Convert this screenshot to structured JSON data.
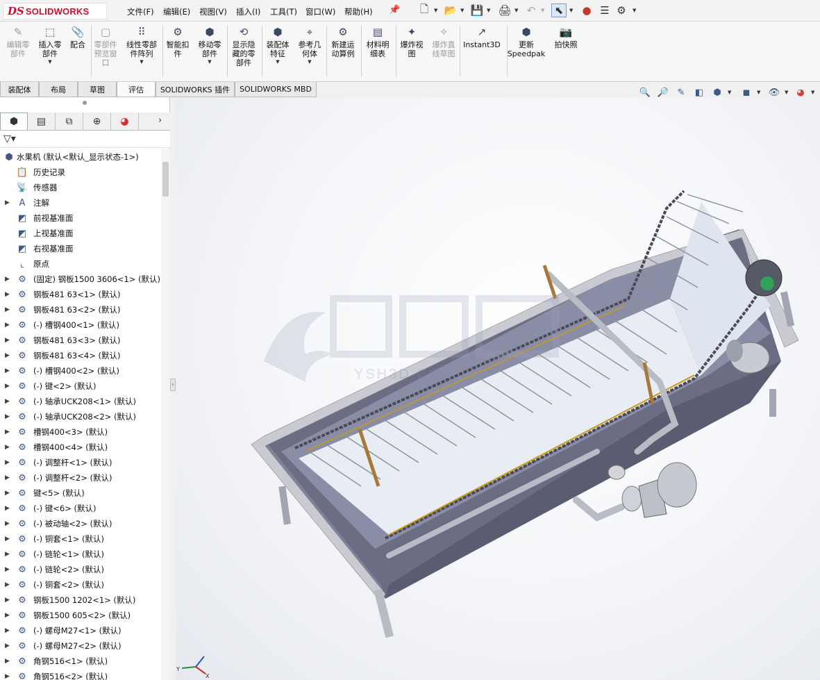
{
  "app": {
    "brand_mark": "DS",
    "brand_name": "SOLIDWORKS"
  },
  "menu": [
    "文件(F)",
    "编辑(E)",
    "视图(V)",
    "插入(I)",
    "工具(T)",
    "窗口(W)",
    "帮助(H)"
  ],
  "ribbon": [
    {
      "label": "编辑零\n部件",
      "icon": "edit-component-icon",
      "enabled": false
    },
    {
      "label": "插入零\n部件",
      "icon": "insert-component-icon",
      "enabled": true,
      "dropdown": true
    },
    {
      "label": "配合",
      "icon": "mate-icon",
      "enabled": true
    },
    {
      "label": "零部件\n预览窗\n口",
      "icon": "component-preview-icon",
      "enabled": false
    },
    {
      "label": "线性零部\n件阵列",
      "icon": "linear-pattern-icon",
      "enabled": true,
      "dropdown": true
    },
    {
      "label": "智能扣\n件",
      "icon": "smart-fasteners-icon",
      "enabled": true
    },
    {
      "label": "移动零\n部件",
      "icon": "move-component-icon",
      "enabled": true,
      "dropdown": true
    },
    {
      "label": "显示隐\n藏的零\n部件",
      "icon": "show-hidden-icon",
      "enabled": true
    },
    {
      "label": "装配体\n特征",
      "icon": "assembly-features-icon",
      "enabled": true,
      "dropdown": true
    },
    {
      "label": "参考几\n何体",
      "icon": "reference-geometry-icon",
      "enabled": true,
      "dropdown": true
    },
    {
      "label": "新建运\n动算例",
      "icon": "new-motion-study-icon",
      "enabled": true
    },
    {
      "label": "材料明\n细表",
      "icon": "bill-of-materials-icon",
      "enabled": true
    },
    {
      "label": "爆炸视\n图",
      "icon": "exploded-view-icon",
      "enabled": true
    },
    {
      "label": "爆炸直\n线草图",
      "icon": "explode-line-sketch-icon",
      "enabled": false
    },
    {
      "label": "Instant3D",
      "icon": "instant3d-icon",
      "enabled": true
    },
    {
      "label": "更新\nSpeedpak",
      "icon": "speedpak-icon",
      "enabled": true
    },
    {
      "label": "拍快照",
      "icon": "snapshot-icon",
      "enabled": true
    }
  ],
  "tabs": [
    "装配体",
    "布局",
    "草图",
    "评估",
    "SOLIDWORKS 插件",
    "SOLIDWORKS MBD"
  ],
  "active_tab": "评估",
  "tree": {
    "root": "水果机 (默认<默认_显示状态-1>)",
    "items": [
      {
        "label": "历史记录",
        "icon": "history-icon",
        "expand": false
      },
      {
        "label": "传感器",
        "icon": "sensor-icon",
        "expand": false
      },
      {
        "label": "注解",
        "icon": "annotations-icon",
        "expand": true
      },
      {
        "label": "前视基准面",
        "icon": "plane-icon",
        "expand": false
      },
      {
        "label": "上视基准面",
        "icon": "plane-icon",
        "expand": false
      },
      {
        "label": "右视基准面",
        "icon": "plane-icon",
        "expand": false
      },
      {
        "label": "原点",
        "icon": "origin-icon",
        "expand": false
      },
      {
        "label": "(固定) 钢板1500 3606<1> (默认)",
        "icon": "part-icon",
        "expand": true
      },
      {
        "label": "钢板481 63<1> (默认)",
        "icon": "part-icon",
        "expand": true
      },
      {
        "label": "钢板481 63<2> (默认)",
        "icon": "part-icon",
        "expand": true
      },
      {
        "label": "(-) 槽钢400<1> (默认)",
        "icon": "part-icon",
        "expand": true
      },
      {
        "label": "钢板481 63<3> (默认)",
        "icon": "part-icon",
        "expand": true
      },
      {
        "label": "钢板481 63<4> (默认)",
        "icon": "part-icon",
        "expand": true
      },
      {
        "label": "(-) 槽钢400<2> (默认)",
        "icon": "part-icon",
        "expand": true
      },
      {
        "label": "(-) 键<2> (默认)",
        "icon": "part-icon",
        "expand": true
      },
      {
        "label": "(-) 轴承UCK208<1> (默认)",
        "icon": "part-icon",
        "expand": true
      },
      {
        "label": "(-) 轴承UCK208<2> (默认)",
        "icon": "part-icon",
        "expand": true
      },
      {
        "label": "槽钢400<3> (默认)",
        "icon": "part-icon",
        "expand": true
      },
      {
        "label": "槽钢400<4> (默认)",
        "icon": "part-icon",
        "expand": true
      },
      {
        "label": "(-) 调整杆<1> (默认)",
        "icon": "part-icon",
        "expand": true
      },
      {
        "label": "(-) 调整杆<2> (默认)",
        "icon": "part-icon",
        "expand": true
      },
      {
        "label": "键<5> (默认)",
        "icon": "part-icon",
        "expand": true
      },
      {
        "label": "(-) 键<6> (默认)",
        "icon": "part-icon",
        "expand": true
      },
      {
        "label": "(-) 被动轴<2> (默认)",
        "icon": "part-icon",
        "expand": true
      },
      {
        "label": "(-) 铜套<1> (默认)",
        "icon": "part-icon",
        "expand": true
      },
      {
        "label": "(-) 链轮<1> (默认)",
        "icon": "part-icon",
        "expand": true
      },
      {
        "label": "(-) 链轮<2> (默认)",
        "icon": "part-icon",
        "expand": true
      },
      {
        "label": "(-) 铜套<2> (默认)",
        "icon": "part-icon",
        "expand": true
      },
      {
        "label": "钢板1500 1202<1> (默认)",
        "icon": "part-icon",
        "expand": true
      },
      {
        "label": "钢板1500 605<2> (默认)",
        "icon": "part-icon",
        "expand": true
      },
      {
        "label": "(-) 螺母M27<1> (默认)",
        "icon": "part-icon",
        "expand": true
      },
      {
        "label": "(-) 螺母M27<2> (默认)",
        "icon": "part-icon",
        "expand": true
      },
      {
        "label": "角钢516<1> (默认)",
        "icon": "part-icon",
        "expand": true
      },
      {
        "label": "角钢516<2> (默认)",
        "icon": "part-icon",
        "expand": true
      }
    ]
  },
  "watermark": {
    "text": "YSH3D.COM"
  },
  "triad": {
    "axis_y": "Y",
    "axis_x": "X"
  }
}
